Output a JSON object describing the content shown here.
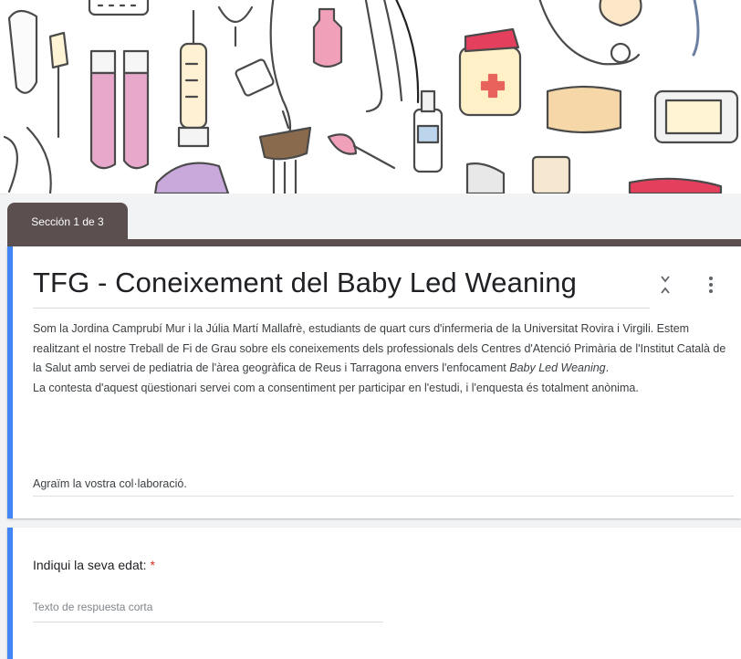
{
  "section": {
    "label": "Sección 1 de 3"
  },
  "form": {
    "title": "TFG - Coneixement del Baby Led Weaning",
    "description": {
      "paragraph_before_italic": "Som la Jordina Camprubí Mur i la Júlia Martí Mallafrè, estudiants de quart curs d'infermeria de la Universitat Rovira i Virgili. Estem realitzant el nostre Treball de Fi de Grau sobre els coneixements dels professionals dels Centres d'Atenció Primària de l'Institut Català de la Salut amb servei de pediatria de l'àrea geogràfica de Reus i Tarragona envers l'enfocament",
      "italic": "Baby Led Weaning",
      "after_italic": ".",
      "consent": "La contesta d'aquest qüestionari servei com a consentiment per participar en l'estudi, i l'enquesta és totalment anònima.",
      "thanks": "Agraïm la vostra col·laboració."
    }
  },
  "question": {
    "label": "Indiqui la seva edat:",
    "required_mark": "*",
    "placeholder": "Texto de respuesta corta"
  },
  "colors": {
    "accent": "#4285f4",
    "section_tab": "#5b4f4f",
    "required": "#d93025"
  },
  "icons": [
    "collapse-icon",
    "more-vert-icon"
  ]
}
